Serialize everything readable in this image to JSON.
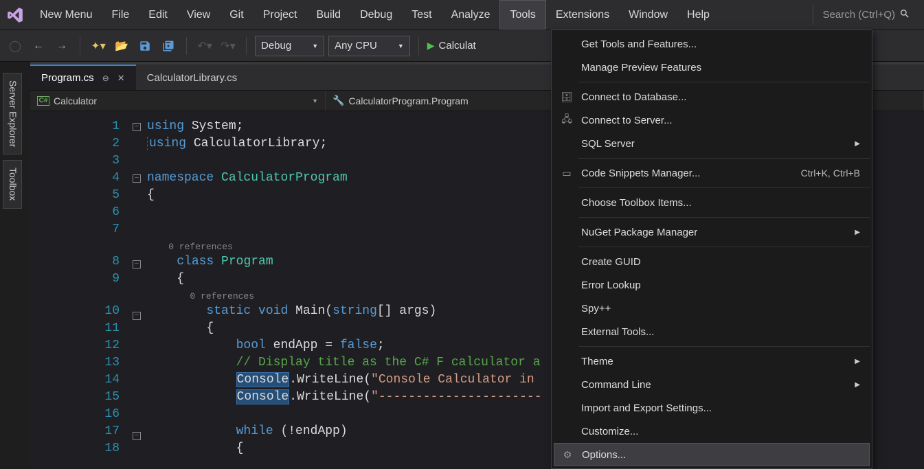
{
  "menubar": {
    "items": [
      "New Menu",
      "File",
      "Edit",
      "View",
      "Git",
      "Project",
      "Build",
      "Debug",
      "Test",
      "Analyze",
      "Tools",
      "Extensions",
      "Window",
      "Help"
    ],
    "active_index": 10,
    "search_placeholder": "Search (Ctrl+Q)"
  },
  "toolbar": {
    "config_combo": "Debug",
    "platform_combo": "Any CPU",
    "run_label": "Calculat"
  },
  "side_tabs": [
    "Server Explorer",
    "Toolbox"
  ],
  "doc_tabs": [
    {
      "label": "Program.cs",
      "active": true,
      "pinned": true
    },
    {
      "label": "CalculatorLibrary.cs",
      "active": false
    }
  ],
  "navbar": {
    "scope": "Calculator",
    "type": "CalculatorProgram.Program"
  },
  "code": {
    "line_nums": [
      1,
      2,
      3,
      4,
      5,
      6,
      7,
      8,
      9,
      10,
      11,
      12,
      13,
      14,
      15,
      16,
      17,
      18
    ],
    "ref_label": "0 references"
  },
  "tools_menu": {
    "items": [
      {
        "label": "Get Tools and Features..."
      },
      {
        "label": "Manage Preview Features"
      },
      {
        "sep": true
      },
      {
        "label": "Connect to Database...",
        "icon": "db"
      },
      {
        "label": "Connect to Server...",
        "icon": "srv"
      },
      {
        "label": "SQL Server",
        "arrow": true
      },
      {
        "sep": true
      },
      {
        "label": "Code Snippets Manager...",
        "icon": "snip",
        "shortcut": "Ctrl+K, Ctrl+B"
      },
      {
        "sep": true
      },
      {
        "label": "Choose Toolbox Items..."
      },
      {
        "sep": true
      },
      {
        "label": "NuGet Package Manager",
        "arrow": true
      },
      {
        "sep": true
      },
      {
        "label": "Create GUID"
      },
      {
        "label": "Error Lookup"
      },
      {
        "label": "Spy++"
      },
      {
        "label": "External Tools..."
      },
      {
        "sep": true
      },
      {
        "label": "Theme",
        "arrow": true
      },
      {
        "label": "Command Line",
        "arrow": true
      },
      {
        "label": "Import and Export Settings..."
      },
      {
        "label": "Customize..."
      },
      {
        "label": "Options...",
        "icon": "gear",
        "hover": true
      }
    ]
  }
}
